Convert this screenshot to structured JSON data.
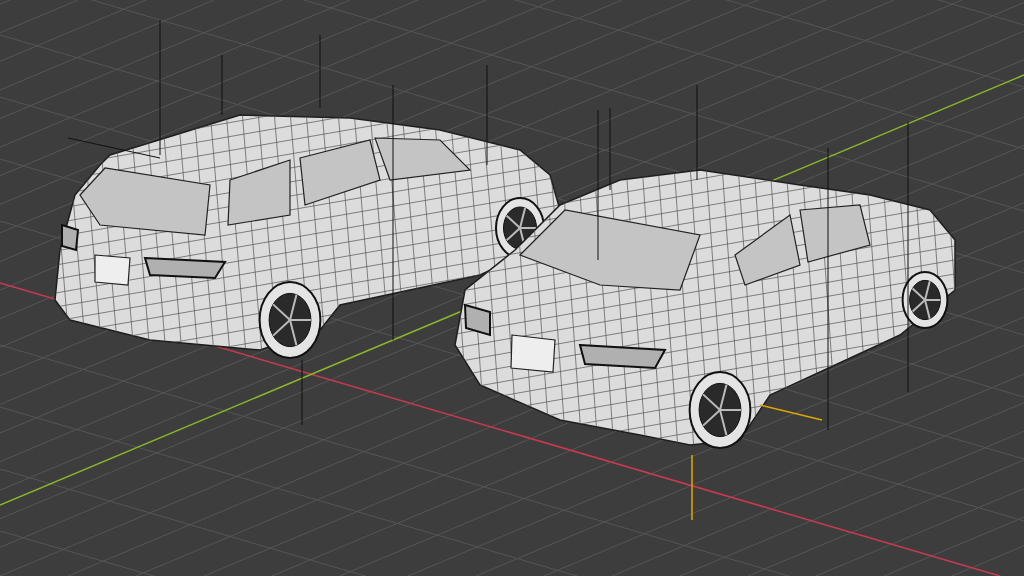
{
  "viewport": {
    "objects": [
      {
        "kind": "wagon"
      },
      {
        "kind": "sedan"
      }
    ],
    "axes": [
      {
        "kind": "x",
        "color": "#c8384f"
      },
      {
        "kind": "y",
        "color": "#8bb52a"
      }
    ]
  }
}
